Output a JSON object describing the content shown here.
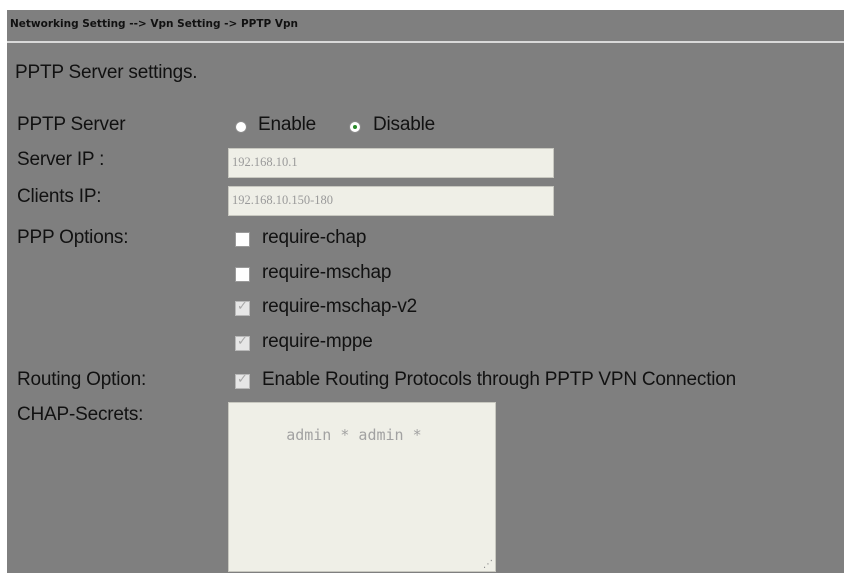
{
  "breadcrumb": "Networking Setting --> Vpn Setting -> PPTP Vpn",
  "section_title": "PPTP Server settings.",
  "pptp_server": {
    "label": "PPTP Server",
    "enable_label": "Enable",
    "disable_label": "Disable",
    "selected": "Disable"
  },
  "server_ip": {
    "label": "Server IP :",
    "value": "192.168.10.1"
  },
  "clients_ip": {
    "label": "Clients IP:",
    "value": "192.168.10.150-180"
  },
  "ppp_options": {
    "label": "PPP Options:",
    "items": [
      {
        "label": "require-chap",
        "checked": false
      },
      {
        "label": "require-mschap",
        "checked": false
      },
      {
        "label": "require-mschap-v2",
        "checked": true
      },
      {
        "label": "require-mppe",
        "checked": true
      }
    ]
  },
  "routing_option": {
    "label": "Routing Option:",
    "checkbox_label": "Enable Routing Protocols through PPTP VPN Connection",
    "checked": true
  },
  "chap_secrets": {
    "label": "CHAP-Secrets:",
    "value": "admin * admin *"
  }
}
